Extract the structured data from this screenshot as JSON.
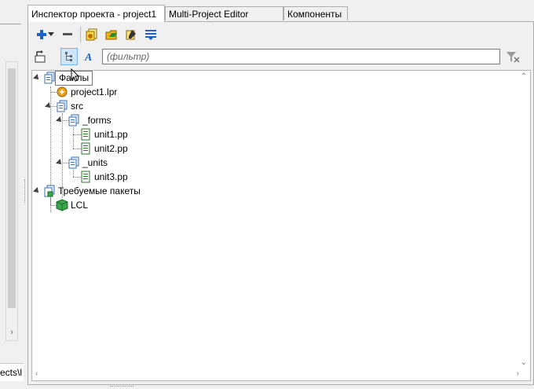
{
  "left_pane": {
    "status_fragment": "ects\\l"
  },
  "tabs": [
    {
      "label": "Инспектор проекта - project1",
      "active": true
    },
    {
      "label": "Multi-Project Editor",
      "active": false
    },
    {
      "label": "Компоненты",
      "active": false
    }
  ],
  "toolbar": {
    "icons": [
      "add-icon",
      "dropdown-arrow-icon",
      "remove-icon",
      "options-icon",
      "open-icon",
      "edit-icon",
      "sort-icon"
    ]
  },
  "filter": {
    "placeholder": "(фильтр)",
    "value": ""
  },
  "tree": {
    "root_files": "Файлы",
    "project_file": "project1.lpr",
    "src": "src",
    "forms": "_forms",
    "unit1": "unit1.pp",
    "unit2": "unit2.pp",
    "units": "_units",
    "unit3": "unit3.pp",
    "required_packages": "Требуемые пакеты",
    "lcl": "LCL"
  },
  "tooltip": "Файлы",
  "colors": {
    "accent_blue": "#1e64c8",
    "pressed_bg": "#cce4f7",
    "package_green": "#3aa84a",
    "lpr_orange": "#e8a020"
  }
}
